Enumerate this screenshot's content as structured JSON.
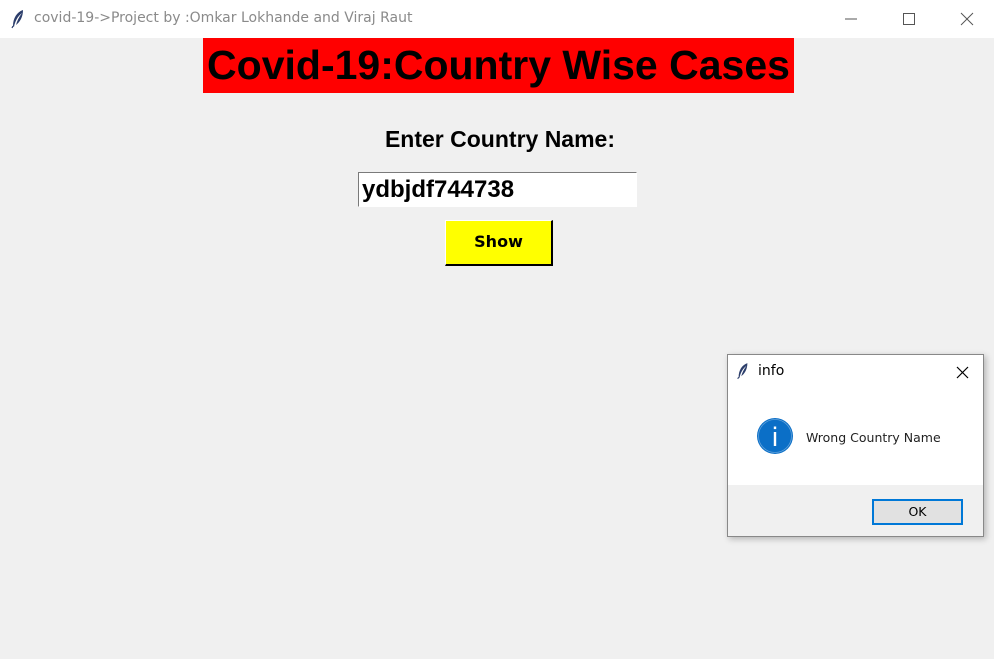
{
  "window": {
    "title": "covid-19->Project by :Omkar Lokhande and Viraj Raut",
    "app_icon": "feather-icon",
    "controls": [
      "minimize-icon",
      "maximize-icon",
      "close-icon"
    ]
  },
  "main": {
    "banner_title": "Covid-19:Country Wise Cases",
    "banner_color": "#ff0000",
    "prompt_label": "Enter Country Name:",
    "country_input_value": "ydbjdf744738",
    "show_button_label": "Show",
    "show_button_color": "#ffff00"
  },
  "dialog": {
    "title": "info",
    "title_icon": "feather-icon",
    "icon": "info-icon",
    "message": "Wrong Country Name",
    "ok_label": "OK",
    "accent_color": "#0078d7"
  }
}
